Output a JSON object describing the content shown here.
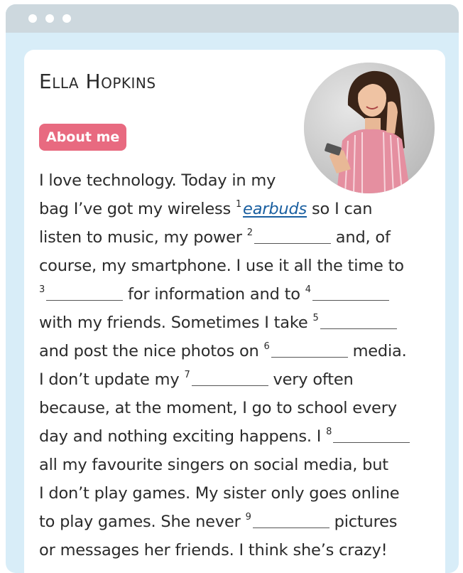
{
  "profile": {
    "name": "Ella Hopkins",
    "badge": "About me"
  },
  "exercise": {
    "l1": "I love technology. Today in my",
    "l2a": "bag I’ve got my wireless",
    "n1": "1",
    "a1": "earbuds",
    "l2b": "so I can",
    "l3a": "listen to music, my power",
    "n2": "2",
    "l3b": "and, of",
    "l4": "course, my smartphone. I use it all the time to",
    "n3": "3",
    "l5a": "for information and to",
    "n4": "4",
    "l6a": "with my friends. Sometimes I take",
    "n5": "5",
    "l7a": "and post the nice photos on",
    "n6": "6",
    "l7b": "media.",
    "l8a": "I don’t update my",
    "n7": "7",
    "l8b": "very often",
    "l9": "because, at the moment, I go to school every",
    "l10a": "day and nothing exciting happens. I",
    "n8": "8",
    "l11": "all my favourite singers on social media, but",
    "l12": "I don’t play games. My sister only goes online",
    "l13a": "to play games. She never",
    "n9": "9",
    "l13b": "pictures",
    "l14": "or messages her friends. I think she’s crazy!"
  },
  "colors": {
    "badge": "#e86a80",
    "frame": "#d8edf8",
    "titlebar": "#cdd8de",
    "answer": "#1a5fa0"
  }
}
